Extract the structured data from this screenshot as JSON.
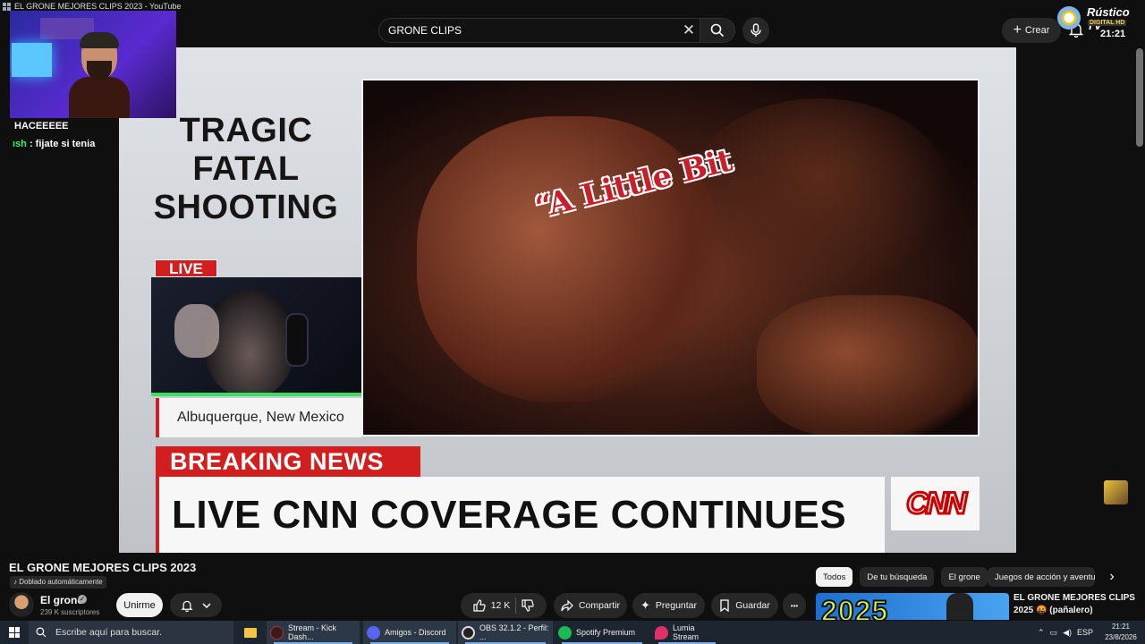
{
  "window": {
    "title": "EL GRONE MEJORES CLIPS 2023 - YouTube"
  },
  "header": {
    "search_value": "GRONE CLIPS",
    "create_label": "Crear",
    "channel_brand": "Rústico TV",
    "channel_brand_sub": "DIGITAL HD",
    "clock": "21:21"
  },
  "overlay_chat": [
    {
      "user": "",
      "text": "HACEEEEE"
    },
    {
      "user": "ısh",
      "text": " : fijate si tenia"
    }
  ],
  "video_content": {
    "headline": "TRAGIC FATAL SHOOTING",
    "clip_caption": "“A Little Bit",
    "live_badge": "LIVE",
    "location": "Albuquerque, New Mexico",
    "breaking": "BREAKING NEWS",
    "lower_third": "LIVE CNN COVERAGE CONTINUES",
    "network": "CNN"
  },
  "video_meta": {
    "title": "EL GRONE MEJORES CLIPS 2023",
    "dubbed": "Doblado automáticamente",
    "channel_name": "El grone",
    "subscribers": "239 K suscriptores",
    "join_label": "Unirme",
    "likes": "12 K",
    "share_label": "Compartir",
    "ask_label": "Preguntar",
    "save_label": "Guardar",
    "more_label": "•••"
  },
  "chips": [
    "Todos",
    "De tu búsqueda",
    "El grone",
    "Juegos de acción y aventura"
  ],
  "recommended": {
    "thumb_text": "2025",
    "title": "EL GRONE MEJORES CLIPS 2025 🤬 (pañalero)"
  },
  "taskbar": {
    "search_placeholder": "Escribe aquí para buscar.",
    "tasks": [
      {
        "label": "Stream - Kick Dash...",
        "color": "#3a1a1a"
      },
      {
        "label": "Amigos - Discord",
        "color": "#5865f2"
      },
      {
        "label": "OBS 32.1.2 - Perfil: ...",
        "color": "#222222"
      },
      {
        "label": "Spotify Premium",
        "color": "#1db954"
      },
      {
        "label": "Lumia Stream",
        "color": "#e0306a"
      }
    ],
    "language": "ESP",
    "time": "21:21",
    "date": "23/8/2026"
  }
}
